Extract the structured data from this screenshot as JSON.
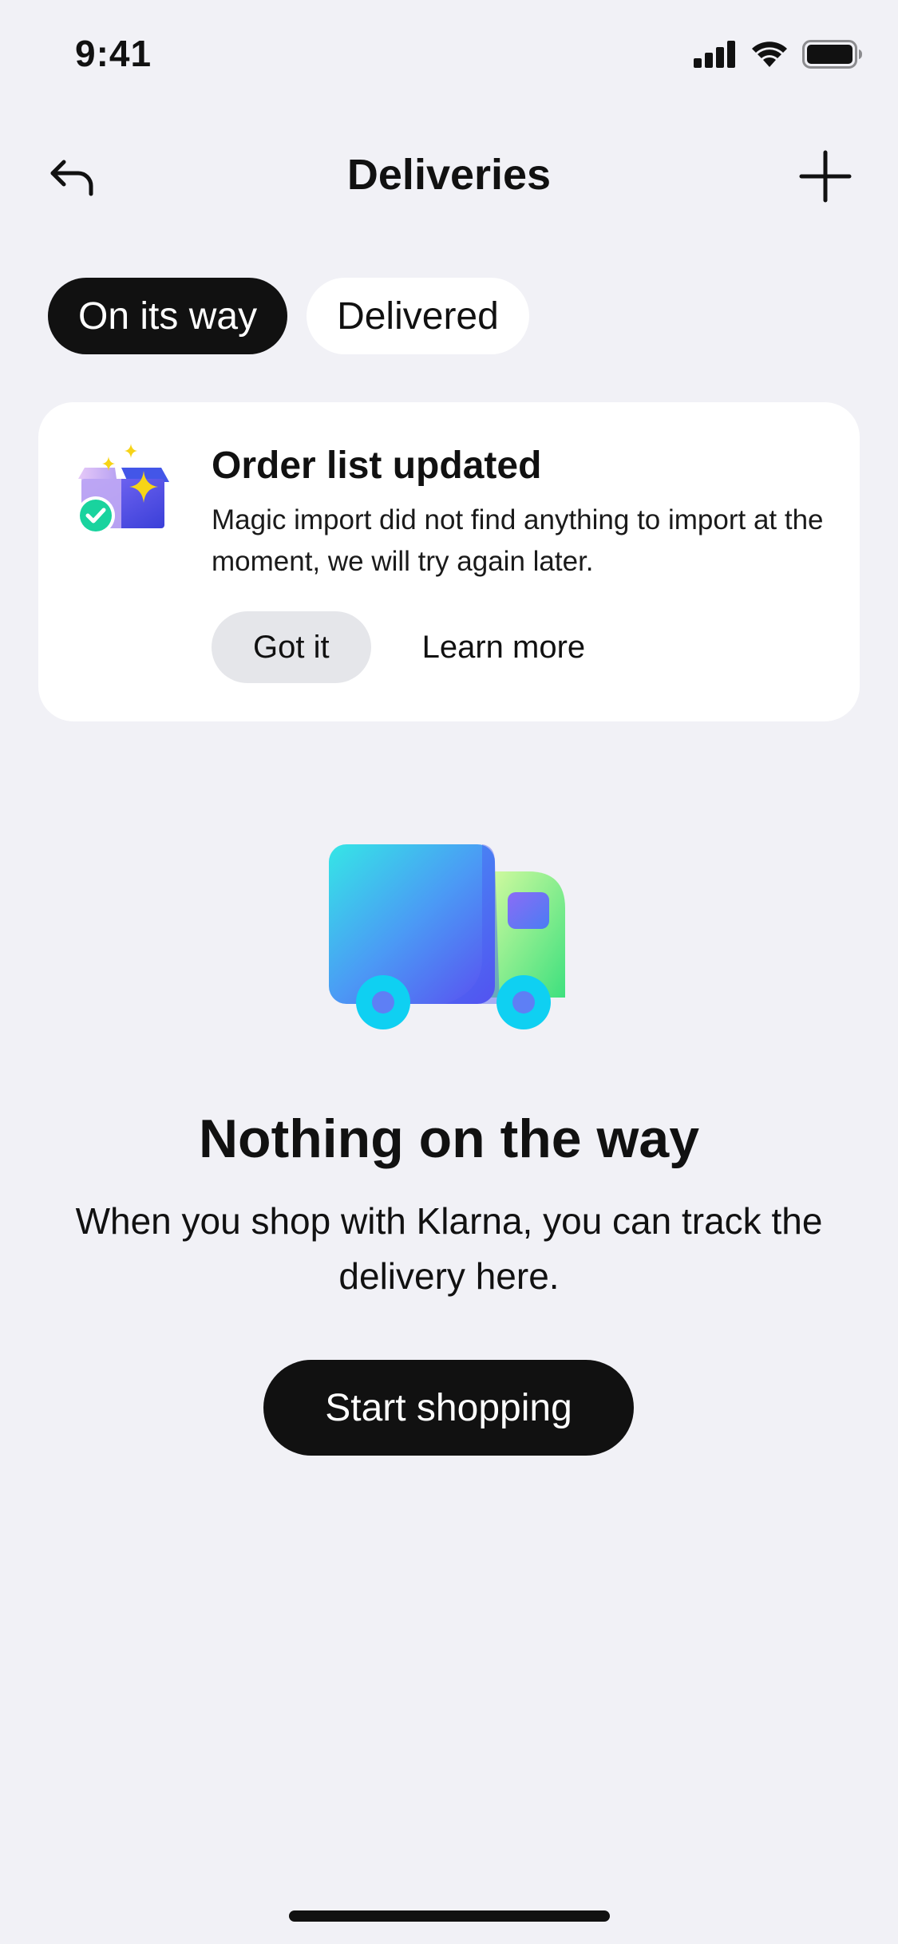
{
  "status_bar": {
    "time": "9:41",
    "icons": [
      "cellular-signal-icon",
      "wifi-icon",
      "battery-icon"
    ]
  },
  "header": {
    "title": "Deliveries",
    "back_icon": "back-arrow-icon",
    "add_icon": "plus-icon"
  },
  "tabs": [
    {
      "label": "On its way",
      "active": true
    },
    {
      "label": "Delivered",
      "active": false
    }
  ],
  "notice_card": {
    "icon": "magic-import-box-icon",
    "title": "Order list updated",
    "message": "Magic import did not find anything to import at the moment, we will try again later.",
    "primary_action": "Got it",
    "secondary_action": "Learn more"
  },
  "empty_state": {
    "icon": "delivery-truck-icon",
    "title": "Nothing on the way",
    "description": "When you shop with Klarna, you can track the delivery here.",
    "cta": "Start shopping"
  },
  "colors": {
    "background": "#f1f1f6",
    "primary": "#111111",
    "card": "#ffffff",
    "secondary_button": "#e5e6ea"
  }
}
